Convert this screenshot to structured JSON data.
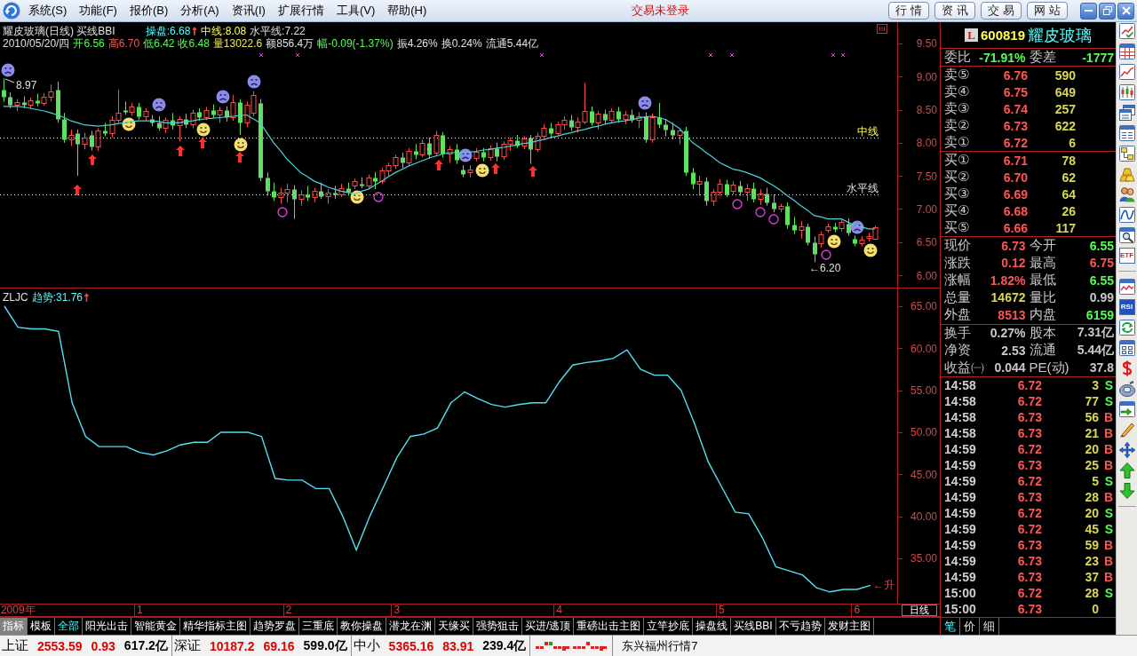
{
  "menu_bar": {
    "items": [
      "系统(S)",
      "功能(F)",
      "报价(B)",
      "分析(A)",
      "资讯(I)",
      "扩展行情",
      "工具(V)",
      "帮助(H)"
    ],
    "login_status": "交易未登录",
    "buttons": [
      "行情",
      "资讯",
      "交易",
      "网站"
    ]
  },
  "price_chart": {
    "header_line_1": [
      {
        "kind": "text",
        "text": "耀皮玻璃(日线) 买线BBI",
        "color": "#e0e0e0"
      },
      {
        "kind": "text",
        "text": "操盘:6.68",
        "color": "#54fcfc"
      },
      {
        "kind": "arrow",
        "text": "↑",
        "color": "#ff4040"
      },
      {
        "kind": "text",
        "text": "中线:8.08",
        "color": "#ffff54"
      },
      {
        "kind": "text",
        "text": "水平线:7.22",
        "color": "#e0e0e0"
      }
    ],
    "header_line_2": [
      {
        "text": "2010/05/20/四",
        "color": "#e0e0e0"
      },
      {
        "text": "开6.56",
        "color": "#54fc54"
      },
      {
        "text": "高6.70",
        "color": "#ff5454"
      },
      {
        "text": "低6.42",
        "color": "#54fc54"
      },
      {
        "text": "收6.48",
        "color": "#54fc54"
      },
      {
        "text": "量13022.6",
        "color": "#e8e854"
      },
      {
        "text": "额856.4万",
        "color": "#e0e0e0"
      },
      {
        "text": "幅-0.09(-1.37%)",
        "color": "#54fc54"
      },
      {
        "text": "振4.26%",
        "color": "#e0e0e0"
      },
      {
        "text": "换0.24%",
        "color": "#e0e0e0"
      },
      {
        "text": "流通5.44亿",
        "color": "#e0e0e0"
      }
    ],
    "high_label": "8.97",
    "low_label": "←6.20",
    "chart_data": {
      "type": "candlestick",
      "categories": [
        null,
        null,
        null,
        null,
        null,
        null,
        null,
        null,
        null,
        null,
        null,
        null,
        null,
        null,
        null,
        null,
        null,
        null,
        null,
        null,
        null,
        null,
        null,
        null,
        null,
        null,
        null,
        null,
        null,
        null,
        null,
        null,
        null,
        null,
        null,
        null,
        null,
        null,
        null,
        null,
        null,
        null,
        null,
        null,
        null,
        null,
        null,
        null,
        null,
        null,
        null,
        null,
        null,
        null,
        null,
        null,
        null,
        null,
        null,
        null,
        null,
        null,
        null,
        null,
        null,
        null,
        null,
        null,
        null,
        null,
        null,
        null,
        null,
        null,
        null,
        null,
        null,
        null,
        null,
        null,
        null,
        null,
        null,
        null,
        null,
        null,
        null,
        null,
        null,
        null,
        null,
        null,
        null,
        null,
        null,
        null,
        null,
        null,
        null,
        null,
        null,
        null,
        null,
        null,
        null,
        null,
        null,
        null,
        null,
        null,
        null,
        null,
        null,
        null,
        null,
        null,
        null,
        null,
        null,
        null,
        null,
        null,
        null,
        null,
        null,
        null,
        null,
        null,
        null,
        null
      ],
      "ohlc": [
        [
          8.8,
          8.97,
          8.62,
          8.7
        ],
        [
          8.7,
          8.76,
          8.52,
          8.58
        ],
        [
          8.58,
          8.66,
          8.48,
          8.62
        ],
        [
          8.62,
          8.7,
          8.52,
          8.57
        ],
        [
          8.57,
          8.68,
          8.52,
          8.64
        ],
        [
          8.64,
          8.74,
          8.55,
          8.6
        ],
        [
          8.6,
          8.75,
          8.56,
          8.7
        ],
        [
          8.7,
          8.88,
          8.62,
          8.78
        ],
        [
          8.8,
          8.92,
          8.3,
          8.36
        ],
        [
          8.36,
          8.45,
          8.0,
          8.05
        ],
        [
          8.05,
          8.2,
          7.95,
          8.12
        ],
        [
          8.15,
          8.2,
          7.5,
          7.98
        ],
        [
          7.98,
          8.15,
          7.9,
          8.08
        ],
        [
          8.12,
          8.18,
          7.88,
          7.95
        ],
        [
          7.95,
          8.22,
          7.88,
          8.18
        ],
        [
          8.18,
          8.3,
          8.1,
          8.15
        ],
        [
          8.15,
          8.4,
          8.08,
          8.35
        ],
        [
          8.35,
          8.8,
          8.3,
          8.45
        ],
        [
          8.5,
          8.62,
          8.42,
          8.46
        ],
        [
          8.46,
          8.6,
          8.41,
          8.55
        ],
        [
          8.55,
          8.6,
          8.35,
          8.4
        ],
        [
          8.4,
          8.52,
          8.32,
          8.48
        ],
        [
          8.36,
          8.42,
          8.25,
          8.3
        ],
        [
          8.3,
          8.4,
          8.18,
          8.22
        ],
        [
          8.22,
          8.38,
          8.15,
          8.34
        ],
        [
          8.34,
          8.45,
          8.2,
          8.26
        ],
        [
          8.26,
          8.4,
          8.02,
          8.36
        ],
        [
          8.36,
          8.44,
          8.22,
          8.28
        ],
        [
          8.28,
          8.5,
          8.22,
          8.45
        ],
        [
          8.46,
          8.52,
          8.33,
          8.38
        ],
        [
          8.38,
          8.54,
          8.34,
          8.5
        ],
        [
          8.5,
          8.58,
          8.38,
          8.42
        ],
        [
          8.42,
          8.54,
          8.3,
          8.5
        ],
        [
          8.5,
          8.55,
          8.32,
          8.38
        ],
        [
          8.38,
          8.72,
          8.33,
          8.62
        ],
        [
          8.62,
          8.66,
          8.12,
          8.3
        ],
        [
          8.3,
          8.62,
          8.24,
          8.58
        ],
        [
          8.45,
          8.78,
          8.4,
          8.72
        ],
        [
          8.6,
          8.66,
          7.42,
          7.48
        ],
        [
          7.48,
          7.55,
          7.2,
          7.28
        ],
        [
          7.28,
          7.4,
          7.12,
          7.18
        ],
        [
          7.18,
          7.32,
          7.08,
          7.25
        ],
        [
          7.25,
          7.38,
          7.1,
          7.3
        ],
        [
          7.3,
          7.36,
          6.85,
          7.15
        ],
        [
          7.15,
          7.28,
          7.05,
          7.22
        ],
        [
          7.22,
          7.35,
          7.12,
          7.18
        ],
        [
          7.18,
          7.32,
          7.1,
          7.28
        ],
        [
          7.28,
          7.4,
          7.15,
          7.2
        ],
        [
          7.2,
          7.3,
          7.08,
          7.25
        ],
        [
          7.25,
          7.35,
          7.15,
          7.22
        ],
        [
          7.22,
          7.38,
          7.18,
          7.32
        ],
        [
          7.32,
          7.4,
          7.2,
          7.26
        ],
        [
          7.36,
          7.46,
          7.3,
          7.42
        ],
        [
          7.38,
          7.48,
          7.31,
          7.35
        ],
        [
          7.35,
          7.52,
          7.3,
          7.48
        ],
        [
          7.48,
          7.56,
          7.3,
          7.42
        ],
        [
          7.42,
          7.62,
          7.38,
          7.58
        ],
        [
          7.58,
          7.7,
          7.5,
          7.66
        ],
        [
          7.66,
          7.82,
          7.6,
          7.78
        ],
        [
          7.78,
          7.85,
          7.62,
          7.7
        ],
        [
          7.7,
          7.92,
          7.66,
          7.88
        ],
        [
          7.88,
          7.98,
          7.75,
          7.82
        ],
        [
          7.82,
          8.05,
          7.78,
          8.0
        ],
        [
          8.0,
          8.08,
          7.76,
          7.82
        ],
        [
          7.85,
          8.18,
          7.8,
          8.12
        ],
        [
          8.12,
          8.16,
          7.78,
          7.84
        ],
        [
          7.84,
          7.95,
          7.7,
          7.9
        ],
        [
          7.9,
          7.98,
          7.68,
          7.74
        ],
        [
          7.6,
          7.66,
          7.48,
          7.53
        ],
        [
          7.55,
          7.66,
          7.48,
          7.6
        ],
        [
          7.77,
          7.92,
          7.72,
          7.86
        ],
        [
          7.86,
          7.92,
          7.72,
          7.78
        ],
        [
          7.78,
          7.96,
          7.73,
          7.92
        ],
        [
          7.92,
          8.0,
          7.72,
          7.8
        ],
        [
          7.8,
          8.02,
          7.74,
          7.98
        ],
        [
          7.98,
          8.08,
          7.88,
          8.04
        ],
        [
          8.04,
          8.12,
          7.92,
          7.96
        ],
        [
          7.96,
          8.1,
          7.9,
          8.06
        ],
        [
          8.08,
          8.12,
          7.68,
          7.9
        ],
        [
          7.9,
          8.15,
          7.86,
          8.1
        ],
        [
          8.1,
          8.28,
          8.05,
          8.22
        ],
        [
          8.22,
          8.3,
          8.08,
          8.14
        ],
        [
          8.14,
          8.32,
          8.1,
          8.28
        ],
        [
          8.28,
          8.4,
          8.2,
          8.35
        ],
        [
          8.35,
          8.42,
          8.18,
          8.24
        ],
        [
          8.24,
          8.38,
          8.15,
          8.32
        ],
        [
          8.32,
          8.9,
          8.28,
          8.48
        ],
        [
          8.48,
          8.55,
          8.26,
          8.3
        ],
        [
          8.3,
          8.48,
          8.2,
          8.44
        ],
        [
          8.44,
          8.5,
          8.28,
          8.34
        ],
        [
          8.34,
          8.52,
          8.3,
          8.48
        ],
        [
          8.48,
          8.54,
          8.3,
          8.36
        ],
        [
          8.36,
          8.48,
          8.28,
          8.42
        ],
        [
          8.42,
          8.5,
          8.3,
          8.34
        ],
        [
          8.34,
          8.46,
          8.22,
          8.4
        ],
        [
          8.4,
          8.46,
          8.0,
          8.05
        ],
        [
          8.05,
          8.44,
          8.0,
          8.38
        ],
        [
          8.38,
          8.6,
          8.22,
          8.28
        ],
        [
          8.28,
          8.36,
          8.1,
          8.2
        ],
        [
          8.2,
          8.3,
          8.05,
          8.12
        ],
        [
          8.12,
          8.22,
          7.98,
          8.18
        ],
        [
          8.18,
          8.24,
          7.5,
          7.55
        ],
        [
          7.55,
          7.62,
          7.3,
          7.38
        ],
        [
          7.38,
          7.5,
          7.2,
          7.42
        ],
        [
          7.42,
          7.48,
          7.05,
          7.12
        ],
        [
          7.12,
          7.3,
          7.05,
          7.26
        ],
        [
          7.26,
          7.45,
          7.2,
          7.38
        ],
        [
          7.38,
          7.44,
          7.18,
          7.22
        ],
        [
          7.27,
          7.42,
          7.22,
          7.37
        ],
        [
          7.35,
          7.42,
          7.2,
          7.26
        ],
        [
          7.26,
          7.38,
          7.12,
          7.32
        ],
        [
          7.32,
          7.4,
          7.1,
          7.16
        ],
        [
          7.16,
          7.3,
          7.06,
          7.24
        ],
        [
          7.24,
          7.32,
          7.05,
          7.1
        ],
        [
          7.1,
          7.22,
          6.95,
          7.0
        ],
        [
          7.0,
          7.08,
          6.95,
          7.04
        ],
        [
          7.04,
          7.1,
          6.7,
          6.76
        ],
        [
          6.76,
          6.88,
          6.62,
          6.68
        ],
        [
          6.68,
          6.82,
          6.55,
          6.74
        ],
        [
          6.74,
          6.78,
          6.45,
          6.5
        ],
        [
          6.5,
          6.58,
          6.2,
          6.32
        ],
        [
          6.48,
          6.66,
          6.42,
          6.62
        ],
        [
          6.69,
          6.78,
          6.64,
          6.74
        ],
        [
          6.74,
          6.79,
          6.65,
          6.7
        ],
        [
          6.71,
          6.84,
          6.66,
          6.8
        ],
        [
          6.78,
          6.86,
          6.6,
          6.64
        ],
        [
          6.55,
          6.6,
          6.44,
          6.49
        ],
        [
          6.49,
          6.59,
          6.44,
          6.54
        ],
        [
          6.57,
          6.64,
          6.51,
          6.59
        ],
        [
          6.55,
          6.75,
          6.55,
          6.73
        ]
      ],
      "series": [
        {
          "type": "line",
          "color": "#50d0d8",
          "values": [
            8.55,
            8.55,
            8.55,
            8.54,
            8.52,
            8.5,
            8.48,
            8.45,
            8.42,
            8.38,
            8.33,
            8.3,
            8.27,
            8.26,
            8.25,
            8.26,
            8.27,
            8.29,
            8.3,
            8.32,
            8.33,
            8.33,
            8.33,
            8.32,
            8.3,
            8.3,
            8.3,
            8.32,
            8.33,
            8.35,
            8.36,
            8.37,
            8.38,
            8.39,
            8.4,
            8.41,
            8.42,
            8.36,
            8.3,
            8.15,
            8.0,
            7.88,
            7.75,
            7.65,
            7.55,
            7.49,
            7.42,
            7.38,
            7.33,
            7.3,
            7.27,
            7.25,
            7.23,
            7.27,
            7.3,
            7.36,
            7.42,
            7.49,
            7.55,
            7.6,
            7.65,
            7.69,
            7.73,
            7.77,
            7.8,
            7.83,
            7.85,
            7.85,
            7.85,
            7.86,
            7.87,
            7.89,
            7.9,
            7.92,
            7.93,
            7.95,
            7.97,
            7.99,
            8.0,
            8.03,
            8.05,
            8.08,
            8.1,
            8.13,
            8.15,
            8.18,
            8.2,
            8.23,
            8.25,
            8.28,
            8.3,
            8.32,
            8.33,
            8.35,
            8.37,
            8.39,
            8.4,
            8.38,
            8.35,
            8.29,
            8.22,
            8.11,
            8.0,
            7.93,
            7.85,
            7.78,
            7.7,
            7.65,
            7.6,
            7.58,
            7.55,
            7.51,
            7.47,
            7.41,
            7.35,
            7.28,
            7.2,
            7.13,
            7.05,
            6.98,
            6.9,
            6.88,
            6.85,
            6.85,
            6.85,
            6.8,
            6.75,
            6.73,
            6.7,
            6.7
          ]
        }
      ],
      "ylim": [
        5.8,
        9.82
      ],
      "yticks": [
        {
          "value": 9.5,
          "label": "9.50"
        },
        {
          "value": 9.0,
          "label": "9.00"
        },
        {
          "value": 8.5,
          "label": "8.50"
        },
        {
          "value": 8.0,
          "label": "8.00"
        },
        {
          "value": 7.5,
          "label": "7.50"
        },
        {
          "value": 7.0,
          "label": "7.00"
        },
        {
          "value": 6.5,
          "label": "6.50"
        },
        {
          "value": 6.0,
          "label": "6.00"
        }
      ],
      "ref_lines": [
        {
          "axis": "y",
          "value": 8.08,
          "label": "中线",
          "color": "#ffff54"
        },
        {
          "axis": "y",
          "value": 7.22,
          "label": "水平线",
          "color": "#e0e0e0"
        }
      ]
    }
  },
  "trend_chart": {
    "header": [
      {
        "kind": "text",
        "text": "ZLJC",
        "color": "#e0e0e0"
      },
      {
        "kind": "text",
        "text": "趋势:31.76",
        "color": "#54fcfc"
      },
      {
        "kind": "arrow",
        "text": "↑",
        "color": "#ff4040"
      }
    ],
    "end_label": "←升",
    "period": "日线",
    "chart_data": {
      "type": "line",
      "categories": [
        null,
        "2009年",
        null,
        null,
        null,
        null,
        null,
        null,
        null,
        null,
        "1",
        null,
        null,
        null,
        null,
        null,
        null,
        null,
        null,
        null,
        null,
        "2",
        null,
        null,
        null,
        null,
        null,
        null,
        null,
        "3",
        null,
        null,
        null,
        null,
        null,
        null,
        null,
        null,
        null,
        null,
        null,
        "4",
        null,
        null,
        null,
        null,
        null,
        null,
        null,
        null,
        null,
        null,
        null,
        "5",
        null,
        null,
        null,
        null,
        null,
        null,
        null,
        null,
        null,
        "6",
        null
      ],
      "series": [
        {
          "color": "#54e0f0",
          "values": [
            65.0,
            62.5,
            62.3,
            62.3,
            62.0,
            53.5,
            49.5,
            48.3,
            48.3,
            48.3,
            47.6,
            47.3,
            47.8,
            48.5,
            48.8,
            48.8,
            50.0,
            50.0,
            50.0,
            49.5,
            44.5,
            44.3,
            44.3,
            43.3,
            43.3,
            40.0,
            36.0,
            40.0,
            43.5,
            47.0,
            49.5,
            49.8,
            50.5,
            53.5,
            54.8,
            54.0,
            53.3,
            53.0,
            53.3,
            53.5,
            53.5,
            56.0,
            58.0,
            58.3,
            58.5,
            58.8,
            59.8,
            57.5,
            56.8,
            56.8,
            55.0,
            51.0,
            46.5,
            43.5,
            40.5,
            40.3,
            37.5,
            34.0,
            33.5,
            33.0,
            31.5,
            31.0,
            31.3,
            31.3,
            31.8
          ]
        }
      ],
      "ylim": [
        29.61,
        67.11
      ],
      "yticks": [
        {
          "value": 65,
          "label": "65.00"
        },
        {
          "value": 60,
          "label": "60.00"
        },
        {
          "value": 55,
          "label": "55.00"
        },
        {
          "value": 50,
          "label": "50.00"
        },
        {
          "value": 45,
          "label": "45.00"
        },
        {
          "value": 40,
          "label": "40.00"
        },
        {
          "value": 35,
          "label": "35.00"
        }
      ]
    }
  },
  "mode_tabs": [
    {
      "label": "指标",
      "selected": true
    },
    {
      "label": "模板",
      "selected": false
    }
  ],
  "indicator_tabs": [
    {
      "label": "全部",
      "selected": true
    },
    {
      "label": "阳光出击",
      "selected": false
    },
    {
      "label": "智能黄金",
      "selected": false
    },
    {
      "label": "精华指标主图",
      "selected": false
    },
    {
      "label": "趋势罗盘",
      "selected": false
    },
    {
      "label": "三重底",
      "selected": false
    },
    {
      "label": "教你操盘",
      "selected": false
    },
    {
      "label": "潜龙在渊",
      "selected": false
    },
    {
      "label": "天缘买",
      "selected": false
    },
    {
      "label": "强势狙击",
      "selected": false
    },
    {
      "label": "买进/逃顶",
      "selected": false
    },
    {
      "label": "重磅出击主图",
      "selected": false
    },
    {
      "label": "立竿抄底",
      "selected": false
    },
    {
      "label": "操盘线",
      "selected": false
    },
    {
      "label": "买线BBI",
      "selected": false
    },
    {
      "label": "不亏趋势",
      "selected": false
    },
    {
      "label": "发财主图",
      "selected": false
    }
  ],
  "quote": {
    "badge": "L",
    "code": "600819",
    "name": "耀皮玻璃",
    "ratio": [
      {
        "label": "委比",
        "value": "-71.91%"
      },
      {
        "label": "委差",
        "value": "-1777"
      }
    ],
    "asks": [
      {
        "label": "卖⑤",
        "price": "6.76",
        "volume": "590"
      },
      {
        "label": "卖④",
        "price": "6.75",
        "volume": "649"
      },
      {
        "label": "卖③",
        "price": "6.74",
        "volume": "257"
      },
      {
        "label": "卖②",
        "price": "6.73",
        "volume": "622"
      },
      {
        "label": "卖①",
        "price": "6.72",
        "volume": "6"
      }
    ],
    "bids": [
      {
        "label": "买①",
        "price": "6.71",
        "volume": "78"
      },
      {
        "label": "买②",
        "price": "6.70",
        "volume": "62"
      },
      {
        "label": "买③",
        "price": "6.69",
        "volume": "64"
      },
      {
        "label": "买④",
        "price": "6.68",
        "volume": "26"
      },
      {
        "label": "买⑤",
        "price": "6.66",
        "volume": "117"
      }
    ],
    "stats": [
      {
        "label": "现价",
        "value": "6.73",
        "color": "#ff5454"
      },
      {
        "label": "今开",
        "value": "6.55",
        "color": "#54fc54"
      },
      {
        "label": "涨跌",
        "value": "0.12",
        "color": "#ff5454"
      },
      {
        "label": "最高",
        "value": "6.75",
        "color": "#ff5454"
      },
      {
        "label": "涨幅",
        "value": "1.82%",
        "color": "#ff5454"
      },
      {
        "label": "最低",
        "value": "6.55",
        "color": "#54fc54"
      },
      {
        "label": "总量",
        "value": "14672",
        "color": "#d8d854"
      },
      {
        "label": "量比",
        "value": "0.99",
        "color": "#c8c8c8"
      },
      {
        "label": "外盘",
        "value": "8513",
        "color": "#ff5454"
      },
      {
        "label": "内盘",
        "value": "6159",
        "color": "#54fc54"
      }
    ],
    "fundamentals": [
      {
        "label": "换手",
        "value": "0.27%"
      },
      {
        "label": "股本",
        "value": "7.31亿"
      },
      {
        "label": "净资",
        "value": "2.53"
      },
      {
        "label": "流通",
        "value": "5.44亿"
      },
      {
        "label": "收益㈠",
        "value": "0.044"
      },
      {
        "label": "PE(动)",
        "value": "37.8"
      }
    ],
    "trades": [
      {
        "time": "14:58",
        "price": "6.72",
        "volume": "3",
        "side": "S",
        "color": "#54fc54"
      },
      {
        "time": "14:58",
        "price": "6.72",
        "volume": "77",
        "side": "S",
        "color": "#54fc54"
      },
      {
        "time": "14:58",
        "price": "6.73",
        "volume": "56",
        "side": "B",
        "color": "#ff5454"
      },
      {
        "time": "14:58",
        "price": "6.73",
        "volume": "21",
        "side": "B",
        "color": "#ff5454"
      },
      {
        "time": "14:59",
        "price": "6.72",
        "volume": "20",
        "side": "B",
        "color": "#ff5454"
      },
      {
        "time": "14:59",
        "price": "6.73",
        "volume": "25",
        "side": "B",
        "color": "#ff5454"
      },
      {
        "time": "14:59",
        "price": "6.72",
        "volume": "5",
        "side": "S",
        "color": "#54fc54"
      },
      {
        "time": "14:59",
        "price": "6.73",
        "volume": "28",
        "side": "B",
        "color": "#ff5454"
      },
      {
        "time": "14:59",
        "price": "6.72",
        "volume": "20",
        "side": "S",
        "color": "#54fc54"
      },
      {
        "time": "14:59",
        "price": "6.72",
        "volume": "45",
        "side": "S",
        "color": "#54fc54"
      },
      {
        "time": "14:59",
        "price": "6.73",
        "volume": "59",
        "side": "B",
        "color": "#ff5454"
      },
      {
        "time": "14:59",
        "price": "6.73",
        "volume": "23",
        "side": "B",
        "color": "#ff5454"
      },
      {
        "time": "14:59",
        "price": "6.73",
        "volume": "37",
        "side": "B",
        "color": "#ff5454"
      },
      {
        "time": "15:00",
        "price": "6.72",
        "volume": "28",
        "side": "S",
        "color": "#54fc54"
      },
      {
        "time": "15:00",
        "price": "6.73",
        "volume": "0"
      }
    ],
    "tabs": [
      {
        "label": "笔",
        "selected": true
      },
      {
        "label": "价",
        "selected": false
      },
      {
        "label": "细",
        "selected": false
      }
    ]
  },
  "side_toolbar": {
    "etf_label": "ETF",
    "rsi_label": "RSI"
  },
  "status_bar": {
    "indices": [
      {
        "name": "上证",
        "value": "2553.59",
        "change": "0.93",
        "amount": "617.2亿"
      },
      {
        "name": "深证",
        "value": "10187.2",
        "change": "69.16",
        "amount": "599.0亿"
      },
      {
        "name": "中小",
        "value": "5365.16",
        "change": "83.91",
        "amount": "239.4亿"
      }
    ],
    "broker": "东兴福州行情7"
  }
}
